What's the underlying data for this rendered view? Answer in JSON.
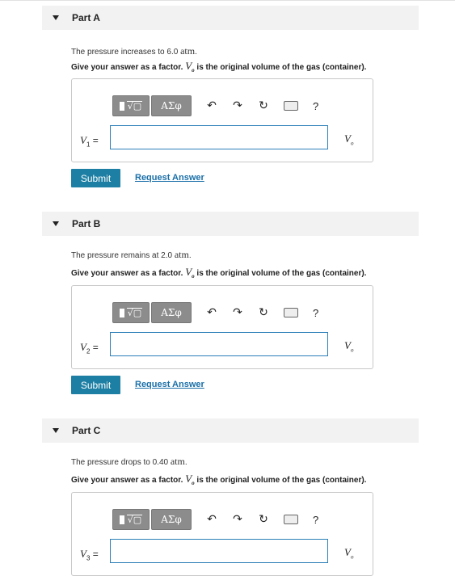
{
  "parts": [
    {
      "title": "Part A",
      "q_text": "The pressure increases to 6.0 ",
      "q_unit": "atm",
      "q_end": ".",
      "instr_pre": "Give your answer as a factor. ",
      "vo": "V",
      "vo_sub": "o",
      "instr_post": " is the original volume of the gas (container).",
      "toolbar": {
        "greek": "ΑΣφ",
        "help": "?"
      },
      "var": "V",
      "var_sub": "1",
      "eq": " =",
      "unit": "V",
      "unit_sub": "o",
      "submit": "Submit",
      "request": "Request Answer"
    },
    {
      "title": "Part B",
      "q_text": "The pressure remains at 2.0 ",
      "q_unit": "atm",
      "q_end": ".",
      "instr_pre": "Give your answer as a factor. ",
      "vo": "V",
      "vo_sub": "o",
      "instr_post": " is the original volume of the gas (container).",
      "toolbar": {
        "greek": "ΑΣφ",
        "help": "?"
      },
      "var": "V",
      "var_sub": "2",
      "eq": " =",
      "unit": "V",
      "unit_sub": "o",
      "submit": "Submit",
      "request": "Request Answer"
    },
    {
      "title": "Part C",
      "q_text": "The pressure drops to 0.40 ",
      "q_unit": "atm",
      "q_end": ".",
      "instr_pre": "Give your answer as a factor. ",
      "vo": "V",
      "vo_sub": "o",
      "instr_post": " is the original volume of the gas (container).",
      "toolbar": {
        "greek": "ΑΣφ",
        "help": "?"
      },
      "var": "V",
      "var_sub": "3",
      "eq": " =",
      "unit": "V",
      "unit_sub": "o"
    }
  ]
}
